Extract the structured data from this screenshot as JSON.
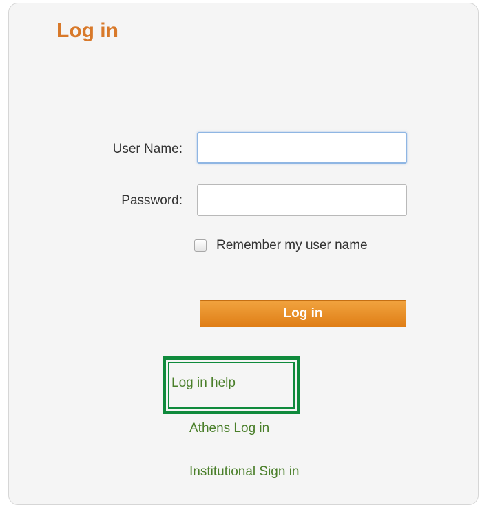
{
  "login_panel": {
    "title": "Log in",
    "username_label": "User Name:",
    "username_value": "",
    "password_label": "Password:",
    "password_value": "",
    "remember_label": "Remember my user name",
    "remember_checked": false,
    "submit_label": "Log in"
  },
  "links": {
    "help": "Log in help",
    "athens": "Athens Log in",
    "institutional": "Institutional Sign in"
  },
  "colors": {
    "title": "#d8792a",
    "button": "#e8902a",
    "link": "#4a7f2a",
    "highlight": "#0f8a3c"
  }
}
